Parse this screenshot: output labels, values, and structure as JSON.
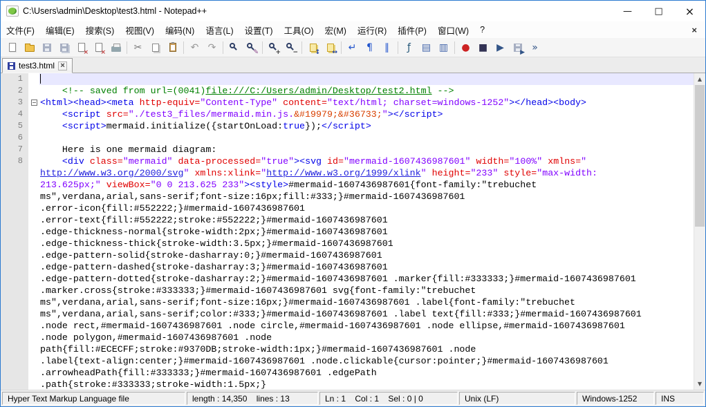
{
  "window": {
    "title": "C:\\Users\\admin\\Desktop\\test3.html - Notepad++",
    "minimize_glyph": "—",
    "maximize_glyph": "□",
    "close_glyph": "×"
  },
  "colors": {
    "window_border": "#2a79d0",
    "current_line_bg": "#e8e8ff",
    "comment": "#008000",
    "tag": "#0000e8",
    "attribute": "#e00000",
    "string": "#8000ff",
    "gutter_bg": "#e6e6e6"
  },
  "menu": {
    "items": [
      {
        "id": "file",
        "label": "文件(F)"
      },
      {
        "id": "edit",
        "label": "编辑(E)"
      },
      {
        "id": "search",
        "label": "搜索(S)"
      },
      {
        "id": "view",
        "label": "视图(V)"
      },
      {
        "id": "encoding",
        "label": "编码(N)"
      },
      {
        "id": "language",
        "label": "语言(L)"
      },
      {
        "id": "settings",
        "label": "设置(T)"
      },
      {
        "id": "tools",
        "label": "工具(O)"
      },
      {
        "id": "macro",
        "label": "宏(M)"
      },
      {
        "id": "run",
        "label": "运行(R)"
      },
      {
        "id": "plugins",
        "label": "插件(P)"
      },
      {
        "id": "window",
        "label": "窗口(W)"
      },
      {
        "id": "help",
        "label": "?"
      }
    ],
    "close_glyph": "×"
  },
  "toolbar": {
    "items": [
      {
        "id": "new-file",
        "kind": "page"
      },
      {
        "id": "open-file",
        "kind": "folder"
      },
      {
        "id": "save-file",
        "kind": "floppy"
      },
      {
        "id": "save-all",
        "kind": "floppy2"
      },
      {
        "id": "close-file",
        "kind": "page",
        "overlay": "×",
        "overlay_color": "#c04040"
      },
      {
        "id": "close-all",
        "kind": "page",
        "overlay": "×",
        "overlay_color": "#c04040"
      },
      {
        "id": "print",
        "kind": "printer"
      },
      {
        "kind": "sep"
      },
      {
        "id": "cut",
        "kind": "glyph",
        "glyph": "✂",
        "color": "#777777"
      },
      {
        "id": "copy",
        "kind": "pages"
      },
      {
        "id": "paste",
        "kind": "clip"
      },
      {
        "kind": "sep"
      },
      {
        "id": "undo",
        "kind": "glyph",
        "glyph": "↶",
        "color": "#999999"
      },
      {
        "id": "redo",
        "kind": "glyph",
        "glyph": "↷",
        "color": "#999999"
      },
      {
        "kind": "sep"
      },
      {
        "id": "find",
        "kind": "mag"
      },
      {
        "id": "replace",
        "kind": "mag",
        "overlay": "✎",
        "overlay_color": "#884488"
      },
      {
        "kind": "sep"
      },
      {
        "id": "zoom-in",
        "kind": "mag",
        "overlay": "+",
        "overlay_color": "#333333"
      },
      {
        "id": "zoom-out",
        "kind": "mag",
        "overlay": "−",
        "overlay_color": "#333333"
      },
      {
        "kind": "sep"
      },
      {
        "id": "sync-vertical-scroll",
        "kind": "ypages",
        "overlay": "↕",
        "overlay_color": "#2244aa"
      },
      {
        "id": "sync-horizontal-scroll",
        "kind": "ypages",
        "overlay": "↔",
        "overlay_color": "#2244aa"
      },
      {
        "kind": "sep"
      },
      {
        "id": "word-wrap",
        "kind": "glyph",
        "glyph": "↵",
        "color": "#2255cc"
      },
      {
        "id": "show-all-characters",
        "kind": "glyph",
        "glyph": "¶",
        "color": "#2255cc"
      },
      {
        "id": "show-indent-guide",
        "kind": "glyph",
        "glyph": "∥",
        "color": "#2255cc"
      },
      {
        "kind": "sep"
      },
      {
        "id": "function-list",
        "kind": "glyph",
        "glyph": "ƒ",
        "color": "#225577"
      },
      {
        "id": "document-map",
        "kind": "glyph",
        "glyph": "▤",
        "color": "#4466aa"
      },
      {
        "id": "document-list",
        "kind": "glyph",
        "glyph": "▥",
        "color": "#4466aa"
      },
      {
        "kind": "sep"
      },
      {
        "id": "start-recording",
        "kind": "glyph",
        "glyph": "●",
        "color": "#cc2222"
      },
      {
        "id": "stop-recording",
        "kind": "glyph",
        "glyph": "■",
        "color": "#333355"
      },
      {
        "id": "playback-macro",
        "kind": "glyph",
        "glyph": "▶",
        "color": "#335588"
      },
      {
        "id": "save-macro",
        "kind": "floppy",
        "overlay": "▶",
        "overlay_color": "#335588"
      },
      {
        "id": "run-macro-multiple",
        "kind": "glyph",
        "glyph": "»",
        "color": "#335588"
      }
    ]
  },
  "tabs": [
    {
      "label": "test3.html",
      "state": "saved",
      "close_glyph": "×"
    }
  ],
  "editor": {
    "scroll_up_glyph": "▲",
    "scroll_down_glyph": "▼",
    "rows": [
      {
        "n": "1",
        "current": true,
        "seg": []
      },
      {
        "n": "2",
        "seg": [
          {
            "t": "    <!-- saved from url=(0041)",
            "c": "g"
          },
          {
            "t": "file:///C:/Users/admin/Desktop/test2.html",
            "c": "gu"
          },
          {
            "t": " -->",
            "c": "g"
          }
        ]
      },
      {
        "n": "3",
        "fold": true,
        "seg": [
          {
            "t": "<html><head><meta ",
            "c": "b"
          },
          {
            "t": "http-equiv=",
            "c": "r"
          },
          {
            "t": "\"Content-Type\"",
            "c": "p"
          },
          {
            "t": " ",
            "c": "k"
          },
          {
            "t": "content=",
            "c": "r"
          },
          {
            "t": "\"text/html; charset=windows-1252\"",
            "c": "p"
          },
          {
            "t": "></head><body>",
            "c": "b"
          }
        ]
      },
      {
        "n": "4",
        "seg": [
          {
            "t": "    ",
            "c": "k"
          },
          {
            "t": "<script ",
            "c": "b"
          },
          {
            "t": "src=",
            "c": "r"
          },
          {
            "t": "\"./test3_files/mermaid.min.js.",
            "c": "p"
          },
          {
            "t": "&#19979;&#36733;",
            "c": "e"
          },
          {
            "t": "\"",
            "c": "p"
          },
          {
            "t": "></script>",
            "c": "b"
          }
        ]
      },
      {
        "n": "5",
        "seg": [
          {
            "t": "    ",
            "c": "k"
          },
          {
            "t": "<script>",
            "c": "b"
          },
          {
            "t": "mermaid.initialize({startOnLoad:",
            "c": "k"
          },
          {
            "t": "true",
            "c": "kw"
          },
          {
            "t": "});",
            "c": "k"
          },
          {
            "t": "</script>",
            "c": "b"
          }
        ]
      },
      {
        "n": "6",
        "seg": []
      },
      {
        "n": "7",
        "seg": [
          {
            "t": "    Here is one mermaid diagram:",
            "c": "k"
          }
        ]
      },
      {
        "n": "8",
        "seg": [
          {
            "t": "    ",
            "c": "k"
          },
          {
            "t": "<div ",
            "c": "b"
          },
          {
            "t": "class=",
            "c": "r"
          },
          {
            "t": "\"mermaid\"",
            "c": "p"
          },
          {
            "t": " ",
            "c": "k"
          },
          {
            "t": "data-processed=",
            "c": "r"
          },
          {
            "t": "\"true\"",
            "c": "p"
          },
          {
            "t": "><svg ",
            "c": "b"
          },
          {
            "t": "id=",
            "c": "r"
          },
          {
            "t": "\"mermaid-1607436987601\"",
            "c": "p"
          },
          {
            "t": " ",
            "c": "k"
          },
          {
            "t": "width=",
            "c": "r"
          },
          {
            "t": "\"100%\"",
            "c": "p"
          },
          {
            "t": " ",
            "c": "k"
          },
          {
            "t": "xmlns=",
            "c": "r"
          },
          {
            "t": "\"",
            "c": "p"
          }
        ]
      },
      {
        "seg": [
          {
            "t": "http://www.w3.org/2000/svg",
            "c": "pu"
          },
          {
            "t": "\"",
            "c": "p"
          },
          {
            "t": " ",
            "c": "k"
          },
          {
            "t": "xmlns:xlink=",
            "c": "r"
          },
          {
            "t": "\"",
            "c": "p"
          },
          {
            "t": "http://www.w3.org/1999/xlink",
            "c": "pu"
          },
          {
            "t": "\"",
            "c": "p"
          },
          {
            "t": " ",
            "c": "k"
          },
          {
            "t": "height=",
            "c": "r"
          },
          {
            "t": "\"233\"",
            "c": "p"
          },
          {
            "t": " ",
            "c": "k"
          },
          {
            "t": "style=",
            "c": "r"
          },
          {
            "t": "\"max-width:",
            "c": "p"
          }
        ]
      },
      {
        "seg": [
          {
            "t": "213.625px;\"",
            "c": "p"
          },
          {
            "t": " ",
            "c": "k"
          },
          {
            "t": "viewBox=",
            "c": "r"
          },
          {
            "t": "\"0 0 213.625 233\"",
            "c": "p"
          },
          {
            "t": "><style>",
            "c": "b"
          },
          {
            "t": "#mermaid-1607436987601{font-family:\"trebuchet",
            "c": "k"
          }
        ]
      },
      {
        "seg": [
          {
            "t": "ms\",verdana,arial,sans-serif;font-size:16px;fill:#333;}#mermaid-1607436987601",
            "c": "k"
          }
        ]
      },
      {
        "seg": [
          {
            "t": ".error-icon{fill:#552222;}#mermaid-1607436987601",
            "c": "k"
          }
        ]
      },
      {
        "seg": [
          {
            "t": ".error-text{fill:#552222;stroke:#552222;}#mermaid-1607436987601",
            "c": "k"
          }
        ]
      },
      {
        "seg": [
          {
            "t": ".edge-thickness-normal{stroke-width:2px;}#mermaid-1607436987601",
            "c": "k"
          }
        ]
      },
      {
        "seg": [
          {
            "t": ".edge-thickness-thick{stroke-width:3.5px;}#mermaid-1607436987601",
            "c": "k"
          }
        ]
      },
      {
        "seg": [
          {
            "t": ".edge-pattern-solid{stroke-dasharray:0;}#mermaid-1607436987601",
            "c": "k"
          }
        ]
      },
      {
        "seg": [
          {
            "t": ".edge-pattern-dashed{stroke-dasharray:3;}#mermaid-1607436987601",
            "c": "k"
          }
        ]
      },
      {
        "seg": [
          {
            "t": ".edge-pattern-dotted{stroke-dasharray:2;}#mermaid-1607436987601 .marker{fill:#333333;}#mermaid-1607436987601",
            "c": "k"
          }
        ]
      },
      {
        "seg": [
          {
            "t": ".marker.cross{stroke:#333333;}#mermaid-1607436987601 svg{font-family:\"trebuchet",
            "c": "k"
          }
        ]
      },
      {
        "seg": [
          {
            "t": "ms\",verdana,arial,sans-serif;font-size:16px;}#mermaid-1607436987601 .label{font-family:\"trebuchet",
            "c": "k"
          }
        ]
      },
      {
        "seg": [
          {
            "t": "ms\",verdana,arial,sans-serif;color:#333;}#mermaid-1607436987601 .label text{fill:#333;}#mermaid-1607436987601",
            "c": "k"
          }
        ]
      },
      {
        "seg": [
          {
            "t": ".node rect,#mermaid-1607436987601 .node circle,#mermaid-1607436987601 .node ellipse,#mermaid-1607436987601",
            "c": "k"
          }
        ]
      },
      {
        "seg": [
          {
            "t": ".node polygon,#mermaid-1607436987601 .node",
            "c": "k"
          }
        ]
      },
      {
        "seg": [
          {
            "t": "path{fill:#ECECFF;stroke:#9370DB;stroke-width:1px;}#mermaid-1607436987601 .node",
            "c": "k"
          }
        ]
      },
      {
        "seg": [
          {
            "t": ".label{text-align:center;}#mermaid-1607436987601 .node.clickable{cursor:pointer;}#mermaid-1607436987601",
            "c": "k"
          }
        ]
      },
      {
        "seg": [
          {
            "t": ".arrowheadPath{fill:#333333;}#mermaid-1607436987601 .edgePath",
            "c": "k"
          }
        ]
      },
      {
        "seg": [
          {
            "t": ".path{stroke:#333333;stroke-width:1.5px;}",
            "c": "k"
          }
        ]
      }
    ]
  },
  "statusbar": {
    "doc_type": "Hyper Text Markup Language file",
    "length_lines": "length : 14,350    lines : 13",
    "caret": "Ln : 1    Col : 1    Sel : 0 | 0",
    "eol": "Unix (LF)",
    "encoding": "Windows-1252",
    "typing_mode": "INS"
  }
}
